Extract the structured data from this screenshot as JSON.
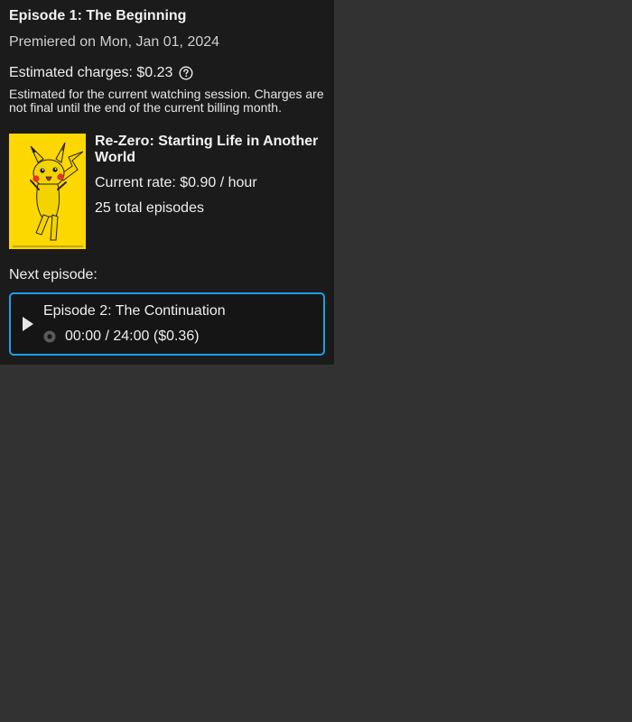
{
  "episode": {
    "title": "Episode 1: The Beginning",
    "premiered": "Premiered on Mon, Jan 01, 2024"
  },
  "charges": {
    "label": "Estimated charges: $0.23",
    "note": "Estimated for the current watching session. Charges are not final until the end of the current billing month."
  },
  "show": {
    "title": "Re-Zero: Starting Life in Another World",
    "rate": "Current rate: $0.90 / hour",
    "total_episodes": "25 total episodes",
    "thumbnail_bg": "#fdd800"
  },
  "next": {
    "label": "Next episode:",
    "title": "Episode 2: The Continuation",
    "progress": "00:00 / 24:00 ($0.36)",
    "accent": "#1a9fe8"
  },
  "icons": {
    "help": "question-circle-icon",
    "play": "play-icon",
    "progress": "radio-dot-icon"
  }
}
